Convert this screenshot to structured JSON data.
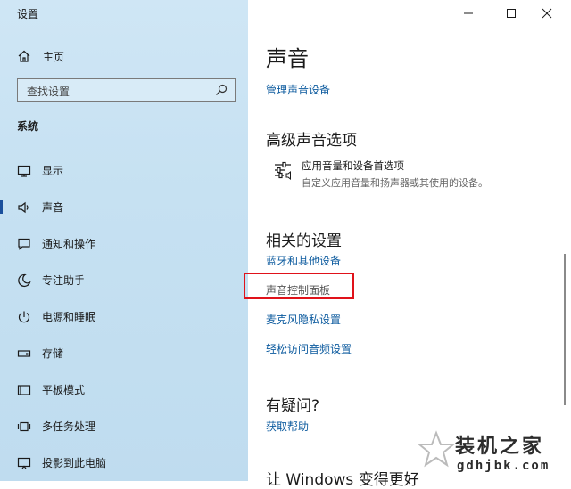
{
  "window": {
    "title": "设置"
  },
  "sidebar": {
    "home_label": "主页",
    "search_placeholder": "查找设置",
    "section_label": "系统",
    "items": [
      {
        "label": "显示",
        "icon": "display-icon"
      },
      {
        "label": "声音",
        "icon": "speaker-icon",
        "active": true
      },
      {
        "label": "通知和操作",
        "icon": "notification-icon"
      },
      {
        "label": "专注助手",
        "icon": "moon-icon"
      },
      {
        "label": "电源和睡眠",
        "icon": "power-icon"
      },
      {
        "label": "存储",
        "icon": "storage-icon"
      },
      {
        "label": "平板模式",
        "icon": "tablet-icon"
      },
      {
        "label": "多任务处理",
        "icon": "multitask-icon"
      },
      {
        "label": "投影到此电脑",
        "icon": "project-icon"
      }
    ]
  },
  "content": {
    "title": "声音",
    "manage_devices_link": "管理声音设备",
    "advanced_heading": "高级声音选项",
    "advanced_item": {
      "title": "应用音量和设备首选项",
      "desc": "自定义应用音量和扬声器或其使用的设备。"
    },
    "related_heading": "相关的设置",
    "related_links": {
      "bluetooth": "蓝牙和其他设备",
      "control_panel": "声音控制面板",
      "mic_privacy": "麦克风隐私设置",
      "ease_audio": "轻松访问音频设置"
    },
    "question_heading": "有疑问?",
    "help_link": "获取帮助",
    "cut_off_heading": "让 Windows 变得更好"
  },
  "watermark": {
    "text": "装机之家",
    "url": "gdhjbk.com"
  },
  "colors": {
    "sidebar_bg": "#c6e1f2",
    "link": "#0b5a9e",
    "active_bar": "#1a4f9c",
    "highlight_box": "#e0121a"
  }
}
